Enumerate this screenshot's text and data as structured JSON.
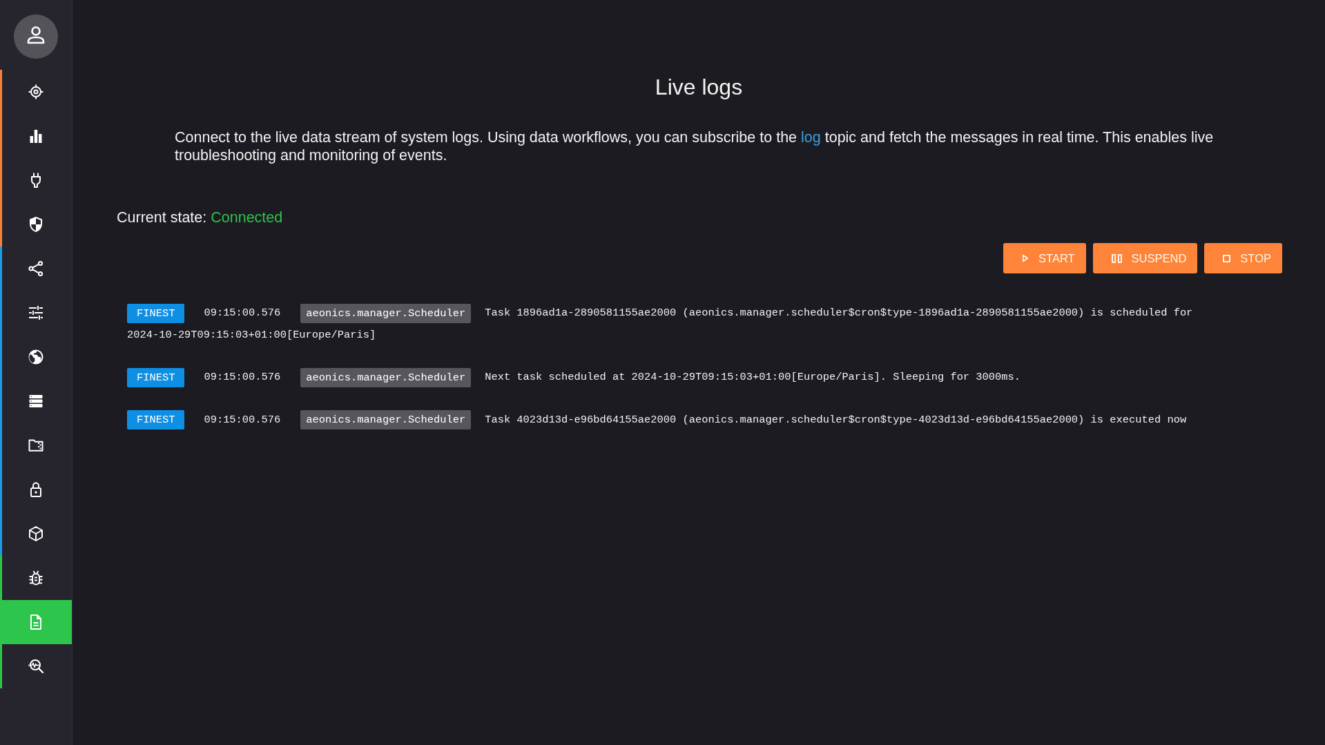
{
  "sidebar": {
    "groups": [
      {
        "color": "#f5843a",
        "items": [
          {
            "selected": false
          },
          {
            "selected": false
          },
          {
            "selected": false
          },
          {
            "selected": false
          }
        ]
      },
      {
        "color": "#1f9be8",
        "items": [
          {
            "selected": false
          },
          {
            "selected": false
          },
          {
            "selected": false
          },
          {
            "selected": false
          },
          {
            "selected": false
          },
          {
            "selected": false
          },
          {
            "selected": false
          }
        ]
      },
      {
        "color": "#2dc54c",
        "items": [
          {
            "selected": false
          },
          {
            "selected": true
          },
          {
            "selected": false
          }
        ]
      }
    ]
  },
  "header": {
    "title": "Live logs"
  },
  "description": [
    {
      "kind": "text",
      "text": "Connect to the live data stream of system logs. Using data workflows, you can subscribe to the "
    },
    {
      "kind": "link",
      "text": "log"
    },
    {
      "kind": "text",
      "text": " topic and fetch the messages in real time. This enables live troubleshooting and monitoring of events."
    }
  ],
  "state": {
    "label": "Current state:",
    "value": "Connected",
    "connected": true
  },
  "buttons": [
    {
      "kind": "start",
      "label": "START"
    },
    {
      "kind": "suspend",
      "label": "SUSPEND"
    },
    {
      "kind": "stop",
      "label": "STOP"
    }
  ],
  "logs": [
    {
      "level": "FINEST",
      "time": "09:15:00.576",
      "logger": "aeonics.manager.Scheduler",
      "message_lines": [
        "Task 1896ad1a-2890581155ae2000 (aeonics.manager.scheduler$cron$type-1896ad1a-2890581155ae2000) is scheduled for",
        "2024-10-29T09:15:03+01:00[Europe/Paris]"
      ]
    },
    {
      "level": "FINEST",
      "time": "09:15:00.576",
      "logger": "aeonics.manager.Scheduler",
      "message_lines": [
        "Next task scheduled at 2024-10-29T09:15:03+01:00[Europe/Paris]. Sleeping for 3000ms."
      ]
    },
    {
      "level": "FINEST",
      "time": "09:15:00.576",
      "logger": "aeonics.manager.Scheduler",
      "message_lines": [
        "Task 4023d13d-e96bd64155ae2000 (aeonics.manager.scheduler$cron$type-4023d13d-e96bd64155ae2000) is executed now"
      ]
    }
  ]
}
